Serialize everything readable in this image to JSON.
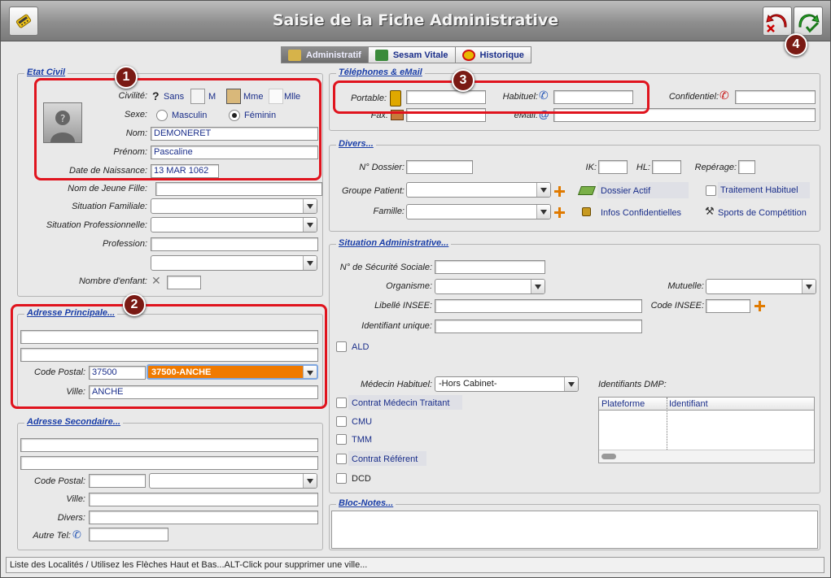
{
  "window": {
    "title": "Saisie de la Fiche Administrative"
  },
  "tabs": [
    {
      "label": "Administratif",
      "active": true
    },
    {
      "label": "Sesam Vitale",
      "active": false
    },
    {
      "label": "Historique",
      "active": false
    }
  ],
  "etat_civil": {
    "title": "Etat Civil",
    "civilite_label": "Civilité:",
    "civilite_options": [
      "Sans",
      "M",
      "Mme",
      "Mlle"
    ],
    "sexe_label": "Sexe:",
    "sexe_options": [
      "Masculin",
      "Féminin"
    ],
    "sexe_selected": "Féminin",
    "nom_label": "Nom:",
    "nom_value": "DEMONERET",
    "prenom_label": "Prénom:",
    "prenom_value": "Pascaline",
    "naissance_label": "Date de Naissance:",
    "naissance_value": "13 MAR 1062",
    "jeune_fille_label": "Nom de Jeune Fille:",
    "situation_familiale_label": "Situation Familiale:",
    "situation_pro_label": "Situation Professionnelle:",
    "profession_label": "Profession:",
    "enfants_label": "Nombre d'enfant:"
  },
  "adresse_principale": {
    "title": "Adresse Principale...",
    "code_postal_label": "Code Postal:",
    "code_postal_value": "37500",
    "localite_value": "37500-ANCHE",
    "ville_label": "Ville:",
    "ville_value": "ANCHE"
  },
  "adresse_secondaire": {
    "title": "Adresse Secondaire...",
    "code_postal_label": "Code Postal:",
    "ville_label": "Ville:",
    "divers_label": "Divers:",
    "autre_tel_label": "Autre Tel:"
  },
  "telephones": {
    "title": "Téléphones & eMail",
    "portable_label": "Portable:",
    "habituel_label": "Habituel:",
    "confidentiel_label": "Confidentiel:",
    "fax_label": "Fax:",
    "email_label": "eMail:"
  },
  "divers": {
    "title": "Divers...",
    "dossier_label": "N° Dossier:",
    "ik_label": "IK:",
    "hl_label": "HL:",
    "reperage_label": "Repérage:",
    "groupe_label": "Groupe Patient:",
    "famille_label": "Famille:",
    "dossier_actif": "Dossier Actif",
    "traitement": "Traitement Habituel",
    "infos_conf": "Infos Confidentielles",
    "sports": "Sports de Compétition"
  },
  "situation_admin": {
    "title": "Situation Administrative...",
    "secu_label": "N° de Sécurité Sociale:",
    "organisme_label": "Organisme:",
    "mutuelle_label": "Mutuelle:",
    "libelle_label": "Libellé INSEE:",
    "code_insee_label": "Code INSEE:",
    "identifiant_label": "Identifiant unique:",
    "ald": "ALD",
    "medecin_label": "Médecin Habituel:",
    "medecin_value": "-Hors Cabinet-",
    "dmp_label": "Identifiants DMP:",
    "dmp_columns": [
      "Plateforme",
      "Identifiant"
    ],
    "checks": [
      "Contrat Médecin Traitant",
      "CMU",
      "TMM",
      "Contrat Référent",
      "DCD"
    ]
  },
  "bloc_notes": {
    "title": "Bloc-Notes..."
  },
  "status_bar": {
    "text": "Liste des Localités / Utilisez les Flèches Haut et Bas...ALT-Click pour supprimer une ville..."
  },
  "badges": [
    "1",
    "2",
    "3",
    "4"
  ],
  "colors": {
    "highlight_red": "#e0141e",
    "selection_orange": "#f07a00",
    "link_blue": "#1a3ea8"
  }
}
